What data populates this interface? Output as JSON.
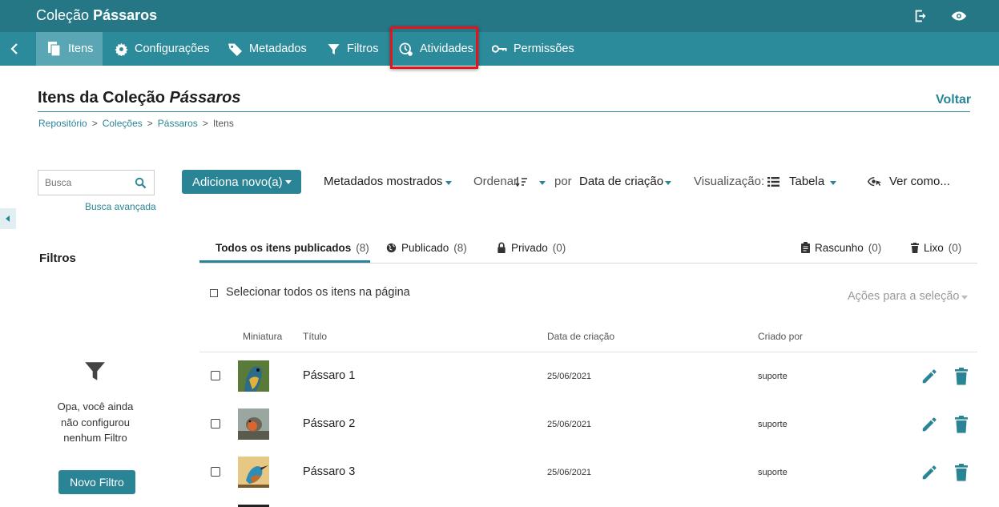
{
  "header": {
    "collection_label": "Coleção",
    "collection_name": "Pássaros",
    "icons": [
      "logout-icon",
      "eye-icon"
    ]
  },
  "nav": {
    "items": [
      {
        "label": "Itens",
        "icon": "items-icon",
        "active": true
      },
      {
        "label": "Configurações",
        "icon": "gear-icon"
      },
      {
        "label": "Metadados",
        "icon": "tag-icon"
      },
      {
        "label": "Filtros",
        "icon": "filter-icon"
      },
      {
        "label": "Atividades",
        "icon": "activity-icon",
        "highlighted": true
      },
      {
        "label": "Permissões",
        "icon": "key-icon"
      }
    ]
  },
  "page": {
    "title_prefix": "Itens da Coleção",
    "title_name": "Pássaros",
    "back_label": "Voltar",
    "breadcrumb": [
      "Repositório",
      "Coleções",
      "Pássaros",
      "Itens"
    ],
    "breadcrumb_separator": ">"
  },
  "search": {
    "placeholder": "Busca",
    "advanced_label": "Busca avançada"
  },
  "toolbar": {
    "add_new_label": "Adiciona novo(a)",
    "shown_metadata_label": "Metadados mostrados",
    "sort_label": "Ordenar",
    "by_label": "por",
    "sort_field": "Data de criação",
    "view_label": "Visualização:",
    "view_mode": "Tabela",
    "view_as_label": "Ver como..."
  },
  "filters": {
    "title": "Filtros",
    "empty_message": "Opa, você ainda não configurou nenhum Filtro",
    "new_filter_label": "Novo Filtro"
  },
  "status_tabs": [
    {
      "label": "Todos os itens publicados",
      "count": "(8)",
      "active": true
    },
    {
      "label": "Publicado",
      "count": "(8)",
      "icon": "globe-icon"
    },
    {
      "label": "Privado",
      "count": "(0)",
      "icon": "lock-icon"
    },
    {
      "label": "Rascunho",
      "count": "(0)",
      "icon": "clipboard-icon"
    },
    {
      "label": "Lixo",
      "count": "(0)",
      "icon": "trash-icon"
    }
  ],
  "selection": {
    "select_all_label": "Selecionar todos os itens na página",
    "bulk_actions_label": "Ações para a seleção"
  },
  "table": {
    "columns": [
      "Miniatura",
      "Título",
      "Data de criação",
      "Criado por"
    ],
    "rows": [
      {
        "title": "Pássaro 1",
        "date": "25/06/2021",
        "author": "suporte",
        "thumb_colors": [
          "#2d6b8a",
          "#e0b23a",
          "#5a7a3a"
        ]
      },
      {
        "title": "Pássaro 2",
        "date": "25/06/2021",
        "author": "suporte",
        "thumb_colors": [
          "#9aa7a0",
          "#d9662e",
          "#5b5a4e"
        ]
      },
      {
        "title": "Pássaro 3",
        "date": "25/06/2021",
        "author": "suporte",
        "thumb_colors": [
          "#e6c783",
          "#2f8db5",
          "#c06a2c"
        ]
      }
    ]
  },
  "colors": {
    "topbar": "#257786",
    "navbar": "#2c8b9a",
    "nav_active": "#5aa6b4",
    "accent": "#298596",
    "highlight": "#e3141b"
  }
}
